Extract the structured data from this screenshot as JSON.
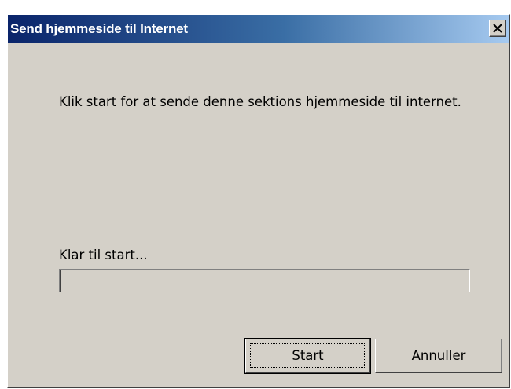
{
  "window": {
    "title": "Send hjemmeside til Internet",
    "close_label": "close"
  },
  "message": {
    "text": "Klik start for at sende denne sektions hjemmeside til internet."
  },
  "status": {
    "text": "Klar til start...",
    "progress_percent": 0
  },
  "buttons": {
    "start_label": "Start",
    "cancel_label": "Annuller"
  },
  "colors": {
    "titlebar_start": "#0a246a",
    "titlebar_end": "#a6caf0",
    "dialog_face": "#d4d0c8"
  },
  "icons": {
    "close": "close-icon"
  }
}
